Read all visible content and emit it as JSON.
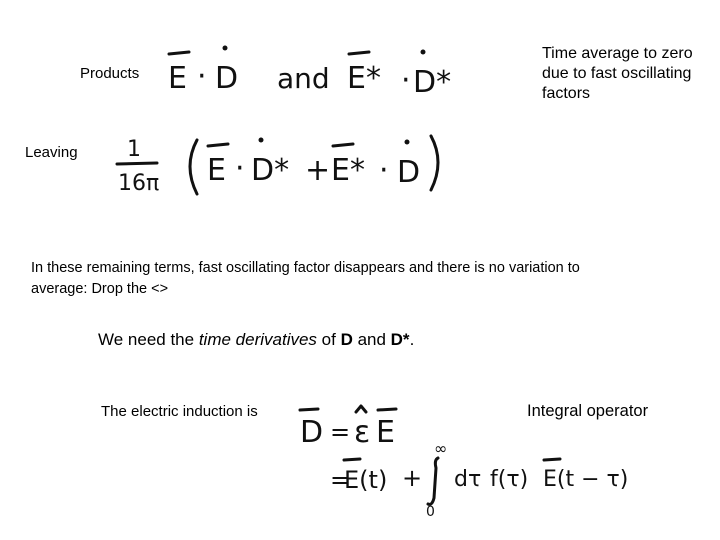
{
  "slide": {
    "products_label": "Products",
    "leaving_label": "Leaving",
    "time_average_note": "Time average to zero due to fast oscillating factors",
    "remaining_terms_line1": "In these remaining terms, fast oscillating factor disappears and there is no variation to",
    "remaining_terms_line2": "average:  Drop the <>",
    "need_prefix": "We need the ",
    "need_italic": "time derivatives",
    "need_middle": " of ",
    "need_bold1": "D",
    "need_and": " and ",
    "need_bold2": "D*",
    "need_suffix": ".",
    "electric_induction_label": "The electric induction is",
    "integral_operator_label": "Integral operator"
  },
  "equations": {
    "products_eq": {
      "term1_E": "E",
      "dot": "·",
      "term1_D": "D",
      "and": "and",
      "term2_E": "E*",
      "term2_D": "D*"
    },
    "leaving_eq": {
      "numerator": "1",
      "denominator": "16π",
      "open_paren": "(",
      "E": "E",
      "dot": "·",
      "Dstar": "D*",
      "plus": "+",
      "Estar": "E*",
      "D": "D",
      "close_paren": ")"
    },
    "induction_eq": {
      "lhs": "D",
      "equals": "=",
      "eps": "ε",
      "E": "E",
      "line2_equals": "=",
      "Et": "E(t)",
      "plus": "+",
      "upper_limit": "∞",
      "lower_limit": "0",
      "integral": "∫",
      "dtau": "dτ",
      "f": "f(τ)",
      "Etau": "E(t − τ)"
    }
  }
}
